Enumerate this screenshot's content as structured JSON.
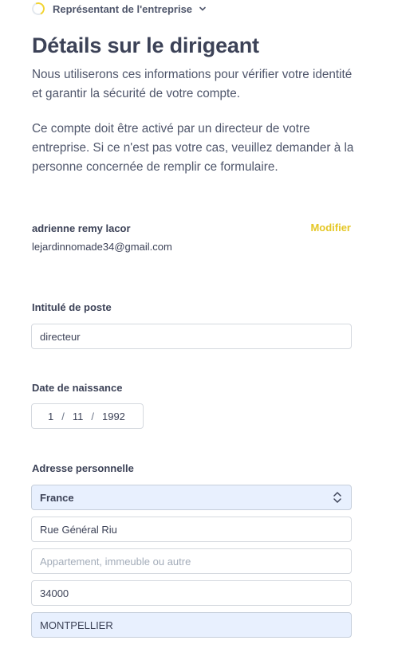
{
  "header": {
    "step_label": "Représentant de l'entreprise"
  },
  "title": "Détails sur le dirigeant",
  "intro": "Nous utiliserons ces informations pour vérifier votre identité et garantir la sécurité de votre compte.",
  "notice": "Ce compte doit être activé par un directeur de votre entreprise. Si ce n'est pas votre cas, veuillez demander à la personne concernée de remplir ce formulaire.",
  "owner": {
    "name": "adrienne remy lacor",
    "email": "lejardinnomade34@gmail.com",
    "modify_label": "Modifier"
  },
  "job_title": {
    "label": "Intitulé de poste",
    "value": "directeur"
  },
  "dob": {
    "label": "Date de naissance",
    "day": "1",
    "month": "11",
    "year": "1992",
    "separator": "/"
  },
  "address": {
    "label": "Adresse personnelle",
    "country": "France",
    "street": "Rue Général Riu",
    "line2_placeholder": "Appartement, immeuble ou autre",
    "postal_code": "34000",
    "city": "MONTPELLIER"
  },
  "colors": {
    "accent": "#e5c726",
    "autofill": "#e8f0fe"
  }
}
